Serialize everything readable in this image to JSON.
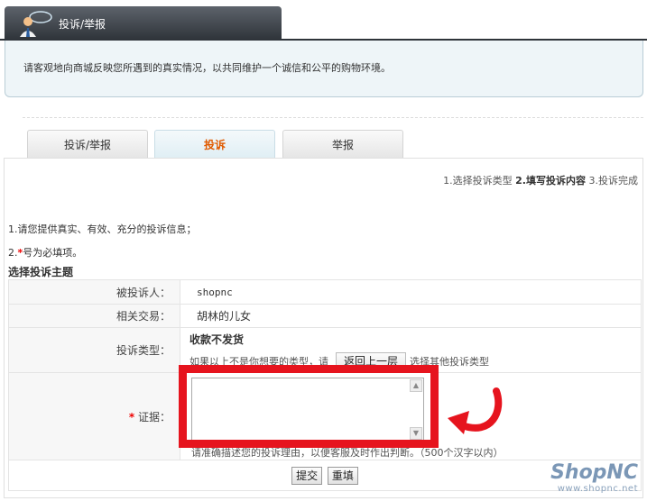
{
  "header": {
    "title": "投诉/举报",
    "logo_icon": "complaint-person-icon"
  },
  "notice": {
    "text": "请客观地向商城反映您所遇到的真实情况，以共同维护一个诚信和公平的购物环境。"
  },
  "tabs": [
    {
      "label": "投诉/举报"
    },
    {
      "label": "投诉"
    },
    {
      "label": "举报"
    }
  ],
  "steps": {
    "step1": "1.选择投诉类型",
    "step2": "2.填写投诉内容",
    "step3": "3.投诉完成"
  },
  "hints": {
    "line1": "1.请您提供真实、有效、充分的投诉信息；",
    "line2_prefix": "2.",
    "line2_star": "*",
    "line2_suffix": "号为必填项。"
  },
  "section": {
    "title": "选择投诉主题"
  },
  "form": {
    "respondent_label": "被投诉人：",
    "respondent_value": "shopnc",
    "trade_label": "相关交易：",
    "trade_value": "胡林的儿女",
    "type_label": "投诉类型：",
    "type_value": "收款不发货",
    "type_hint_before": "如果以上不是你想要的类型，请",
    "back_button": "返回上一层",
    "type_hint_after": "选择其他投诉类型",
    "evidence_star": "*",
    "evidence_label": "证据：",
    "evidence_note": "请准确描述您的投诉理由，以便客服及时作出判断。（500个汉字以内）"
  },
  "buttons": {
    "submit": "提交",
    "reset": "重填"
  },
  "watermark": {
    "brand": "ShopNC",
    "url": "www.shopnc.net"
  },
  "colors": {
    "highlight": "#e6141e",
    "active_tab_text": "#e05a00",
    "header_bg": "#2f343a"
  }
}
